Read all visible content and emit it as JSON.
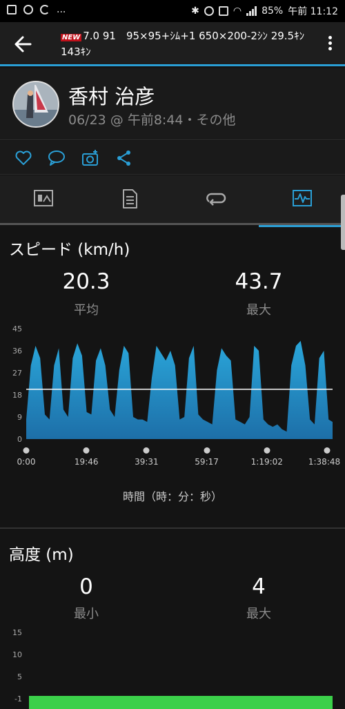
{
  "status_bar": {
    "battery": "85%",
    "time": "午前 11:12",
    "more": "..."
  },
  "appbar": {
    "new_badge": "NEW",
    "title": "7.0 91　95×95+ｼﾑ+1 650×200-2ｼﾝ 29.5ｷﾝ143ｷﾝ"
  },
  "activity": {
    "user_name": "香村 治彦",
    "date": "06/23 @ 午前8:44・その他"
  },
  "icons": {
    "back": "arrow-left-icon",
    "menu": "more-vert-icon",
    "like": "heart-icon",
    "comment": "comment-icon",
    "photo": "add-photo-icon",
    "share": "share-icon",
    "tabs": [
      "summary-icon",
      "details-icon",
      "laps-icon",
      "charts-icon"
    ]
  },
  "colors": {
    "accent": "#2a9fd6",
    "speed_fill": "#2aa6da",
    "elevation_fill": "#3bd04a"
  },
  "speed": {
    "title": "スピード (km/h)",
    "avg_value": "20.3",
    "avg_label": "平均",
    "max_value": "43.7",
    "max_label": "最大"
  },
  "elevation": {
    "title": "高度 (m)",
    "min_value": "0",
    "min_label": "最小",
    "max_value": "4",
    "max_label": "最大"
  },
  "chart_data": [
    {
      "type": "area",
      "ylim": [
        0,
        45
      ],
      "yticks": [
        "45",
        "36",
        "27",
        "18",
        "9",
        "0"
      ],
      "x_tick_labels": [
        "0:00",
        "19:46",
        "39:31",
        "59:17",
        "1:19:02",
        "1:38:48"
      ],
      "xlabel": "時間（時：分：秒）",
      "average_line": 20.3,
      "x_minutes": [
        0,
        1.5,
        3,
        4.5,
        6,
        7.5,
        9,
        10.5,
        12,
        13.5,
        15,
        16.5,
        18,
        19.5,
        21,
        22.5,
        24,
        25.5,
        27,
        28.5,
        30,
        31.5,
        33,
        34.5,
        36,
        37.5,
        39,
        40.5,
        42,
        43.5,
        45,
        46.5,
        48,
        49.5,
        51,
        52.5,
        54,
        55.5,
        57,
        58.5,
        60,
        61.5,
        63,
        64.5,
        66,
        67.5,
        69,
        70.5,
        72,
        73.5,
        75,
        76.5,
        78,
        79.5,
        81,
        82.5,
        84,
        85.5,
        87,
        88.5,
        90,
        91.5,
        93,
        94.5,
        96,
        97.5,
        98.8
      ],
      "values": [
        8,
        30,
        38,
        33,
        10,
        8,
        30,
        37,
        12,
        9,
        33,
        39,
        34,
        11,
        10,
        32,
        37,
        30,
        12,
        9,
        28,
        38,
        35,
        9,
        8,
        8,
        7,
        25,
        38,
        35,
        32,
        36,
        30,
        8,
        9,
        33,
        38,
        10,
        8,
        7,
        6,
        28,
        37,
        34,
        32,
        8,
        7,
        6,
        9,
        38,
        36,
        8,
        6,
        5,
        6,
        4,
        3,
        30,
        38,
        40,
        30,
        8,
        6,
        33,
        36,
        8,
        7
      ]
    },
    {
      "type": "area",
      "yticks": [
        "15",
        "10",
        "5",
        "-1"
      ],
      "ylim": [
        -1,
        15
      ],
      "values": [
        0
      ]
    }
  ]
}
